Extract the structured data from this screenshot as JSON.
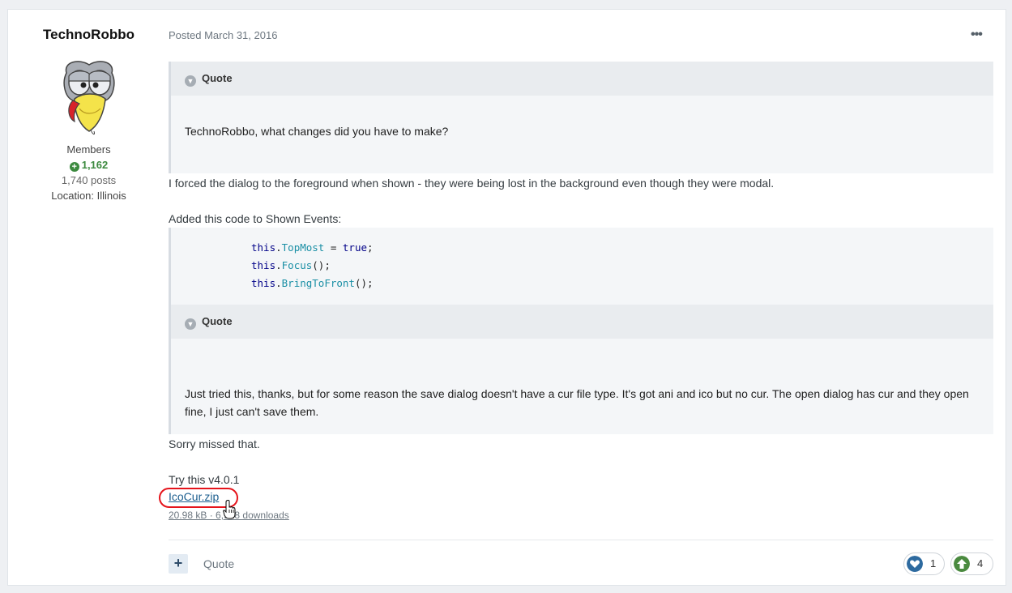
{
  "author": {
    "name": "TechnoRobbo",
    "group": "Members",
    "reputation": "1,162",
    "posts": "1,740 posts",
    "location": "Location: Illinois"
  },
  "post": {
    "date": "Posted March 31, 2016",
    "menu_icon": "ellipsis-icon",
    "quote1": {
      "label": "Quote",
      "body": "TechnoRobbo, what changes did you have to make?"
    },
    "paragraph1": "I forced the dialog to the foreground when shown - they were being lost in the background even though they were modal.",
    "paragraph2": "Added this code to Shown Events:",
    "code": {
      "line1": {
        "obj": "this",
        "dot": ".",
        "member": "TopMost",
        "rest1": " = ",
        "value": "true",
        "end": ";"
      },
      "line2": {
        "obj": "this",
        "dot": ".",
        "member": "Focus",
        "end": "();"
      },
      "line3": {
        "obj": "this",
        "dot": ".",
        "member": "BringToFront",
        "end": "();"
      }
    },
    "quote2": {
      "label": "Quote",
      "body": "Just tried this, thanks, but for some reason the save dialog doesn't have a cur file type. It's got ani and ico but no cur. The open dialog has cur and they open fine, I just can't save them."
    },
    "paragraph3": "Sorry missed that.",
    "paragraph4": "Try this v4.0.1",
    "attachment": {
      "name": "IcoCur.zip",
      "meta": "20.98 kB · 6,918 downloads"
    }
  },
  "footer": {
    "plus_label": "+",
    "quote_label": "Quote",
    "reactions": [
      {
        "icon": "heart-icon",
        "color": "#2d6a9f",
        "count": "1"
      },
      {
        "icon": "upvote-icon",
        "color": "#4a8a3f",
        "count": "4"
      }
    ]
  },
  "colors": {
    "link": "#1c5e8f",
    "reputation": "#3c8a3f",
    "highlight_circle": "#e5141b"
  }
}
